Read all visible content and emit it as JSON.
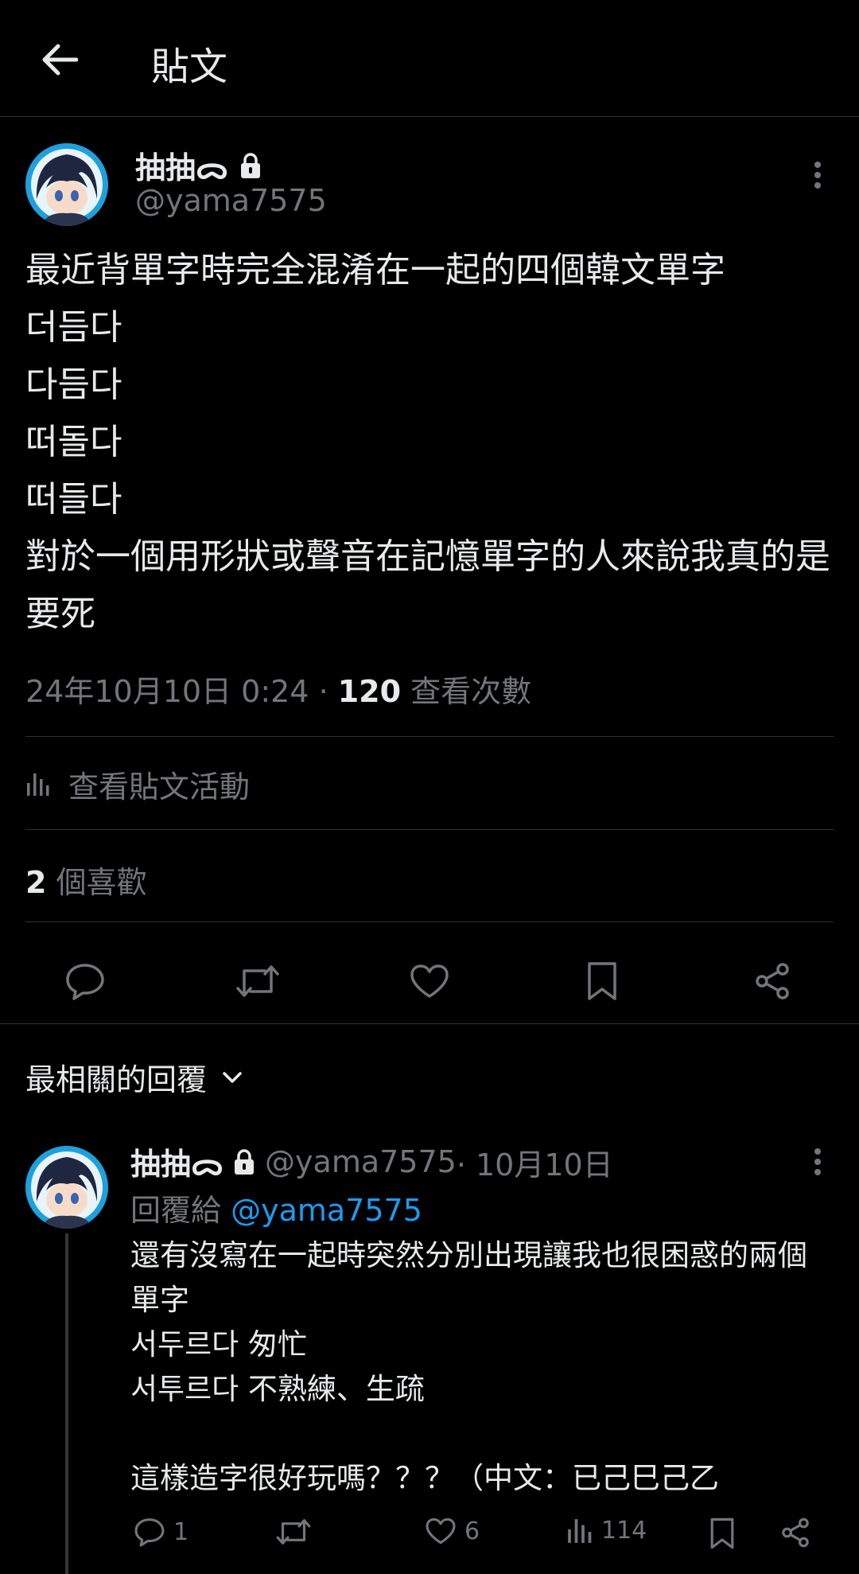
{
  "header": {
    "title": "貼文"
  },
  "post": {
    "author": {
      "display_name": "抽抽ᯅ",
      "handle": "@yama7575",
      "locked": true
    },
    "text": "最近背單字時完全混淆在一起的四個韓文單字\n더듬다\n다듬다\n떠돌다\n떠들다\n對於一個用形狀或聲音在記憶單字的人來說我真的是要死",
    "timestamp": "24年10月10日 0:24",
    "separator": " · ",
    "views": "120",
    "views_label": " 查看次數",
    "activity_label": "查看貼文活動",
    "likes_count": "2",
    "likes_label": " 個喜歡"
  },
  "actions": {
    "icons": [
      "reply-icon",
      "retweet-icon",
      "like-icon",
      "bookmark-icon",
      "share-icon"
    ]
  },
  "replies_sort": {
    "label": "最相關的回覆"
  },
  "reply": {
    "display_name": "抽抽ᯅ",
    "handle": "@yama7575",
    "date": " · 10月10日",
    "reply_to_prefix": "回覆給 ",
    "reply_to_mention": "@yama7575",
    "text": "還有沒寫在一起時突然分別出現讓我也很困惑的兩個單字\n서두르다 匆忙\n서투르다 不熟練、生疏\n\n這樣造字很好玩嗎？？？（中文：已己巳己乙",
    "reply_count": "1",
    "like_count": "6",
    "view_count": "114"
  },
  "colors": {
    "accent": "#1d9bf0",
    "muted": "#71767b",
    "background": "#000000",
    "text": "#e7e9ea",
    "divider": "#2f3336"
  }
}
